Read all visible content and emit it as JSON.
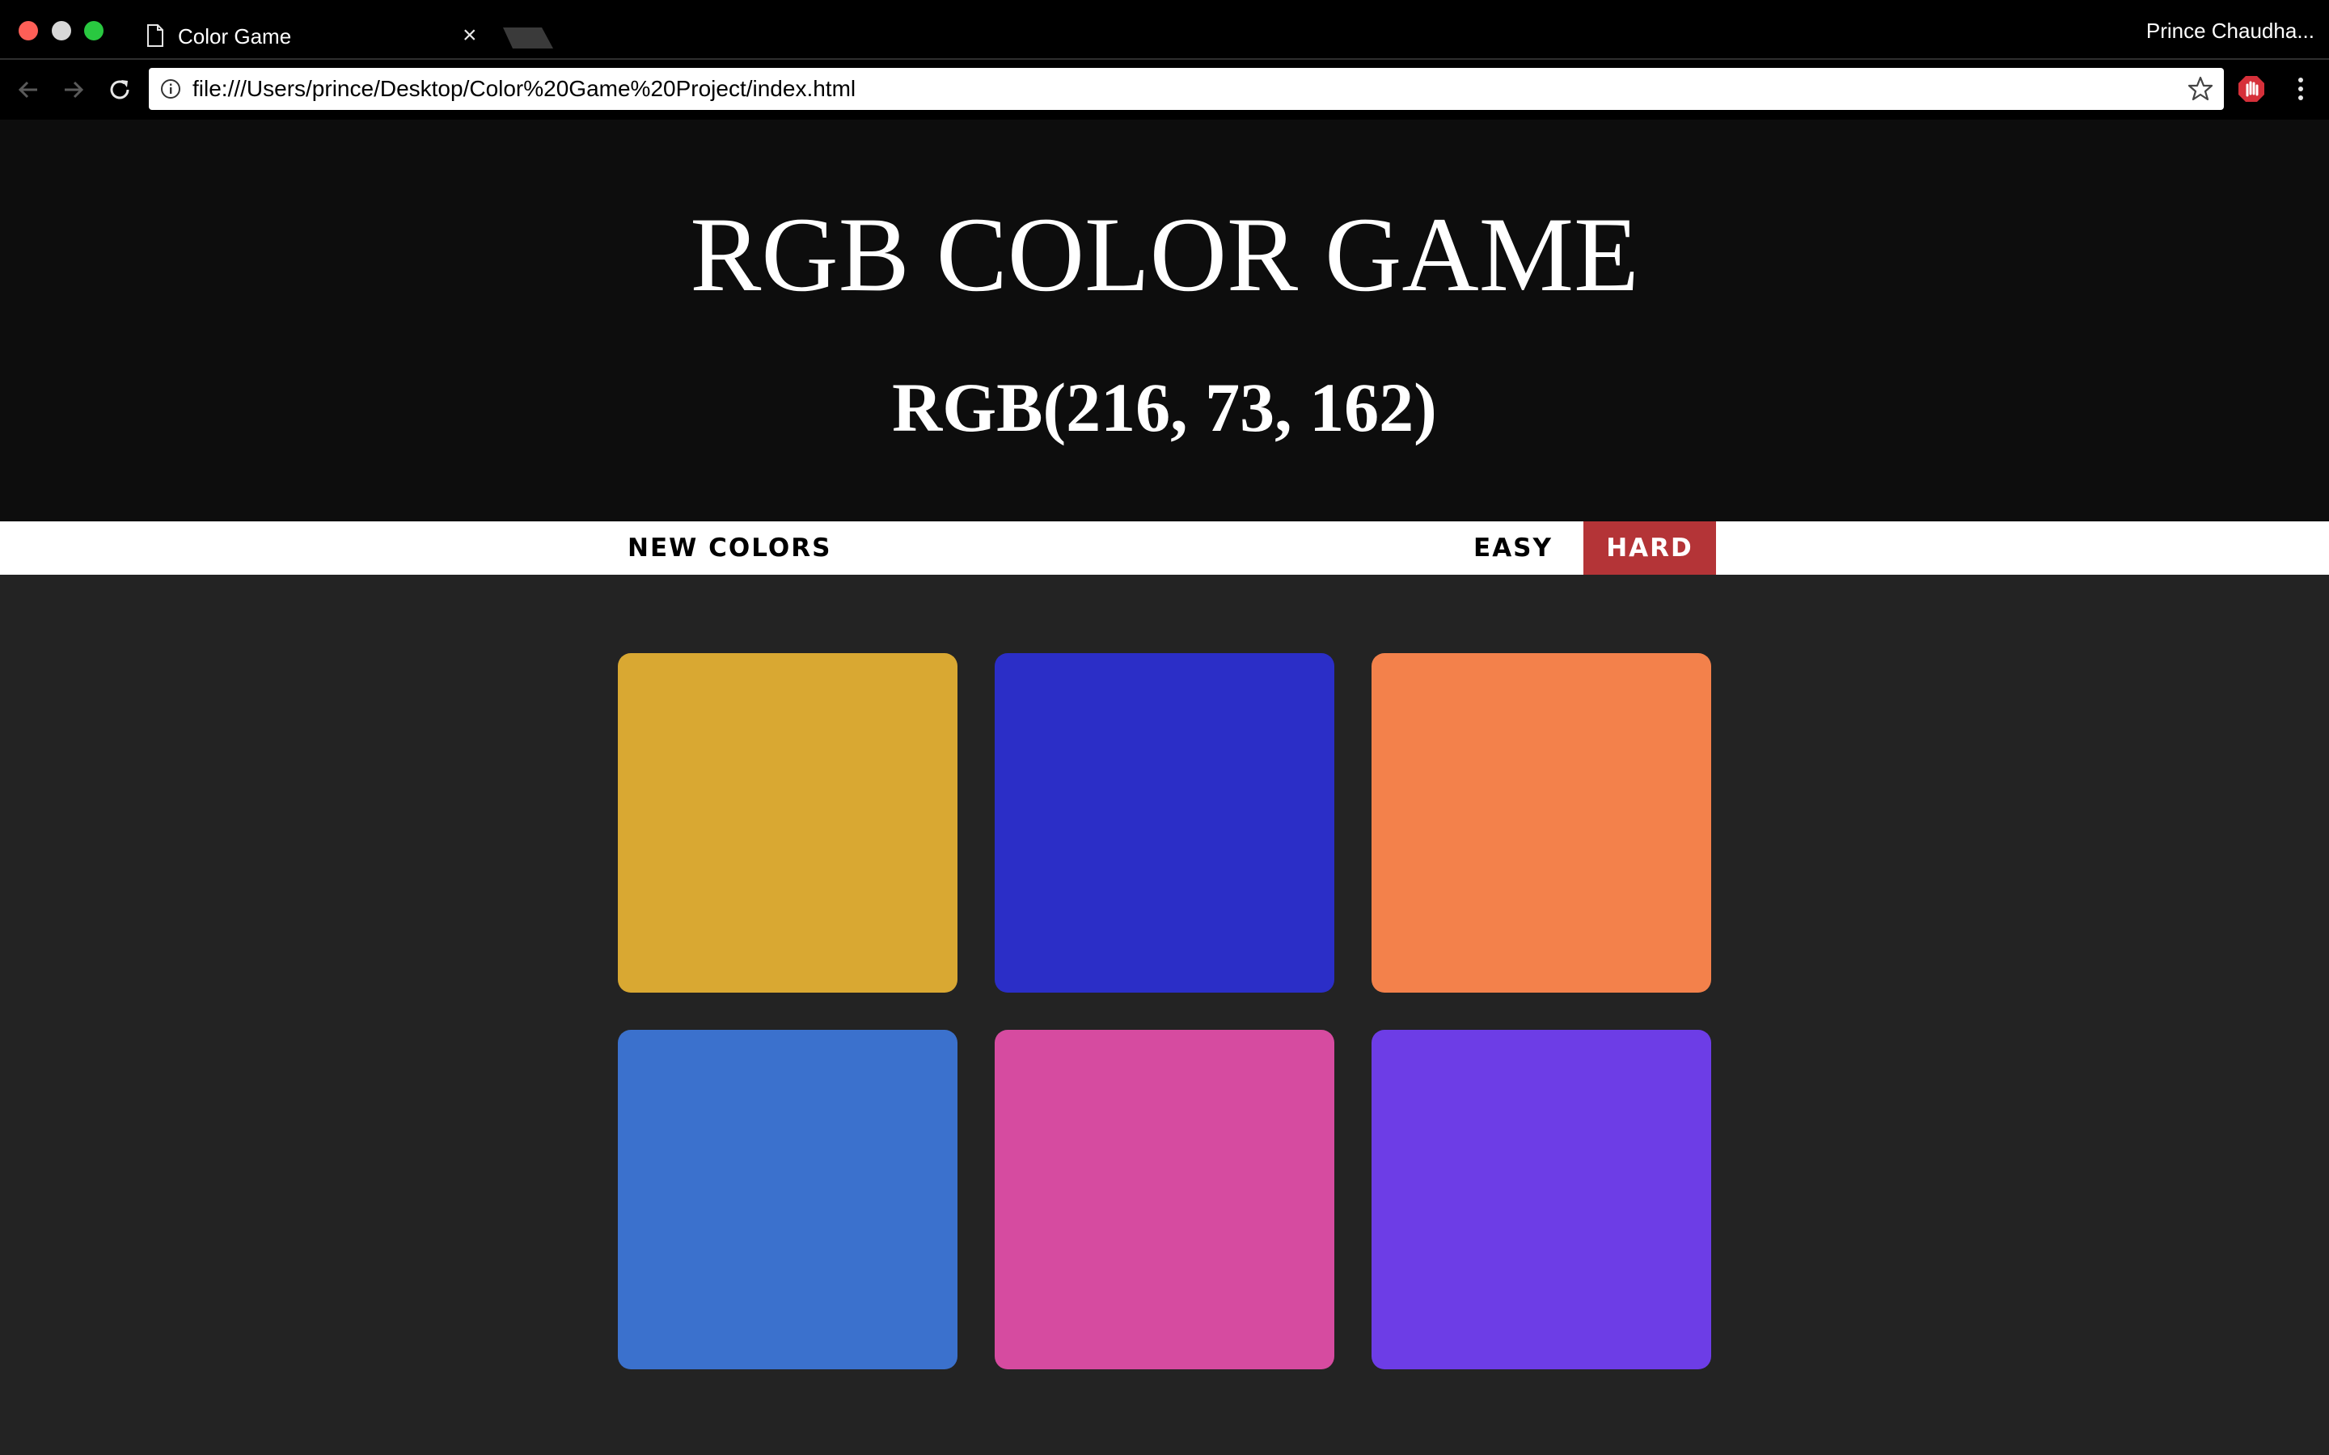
{
  "browser": {
    "tab_title": "Color Game",
    "tab_close": "×",
    "profile_name": "Prince Chaudha...",
    "url": "file:///Users/prince/Desktop/Color%20Game%20Project/index.html",
    "icons": [
      "document-icon",
      "back-icon",
      "forward-icon",
      "reload-icon",
      "info-icon",
      "star-icon",
      "extension-icon",
      "menu-icon"
    ]
  },
  "game": {
    "title": "RGB COLOR GAME",
    "target_color": "RGB(216, 73, 162)",
    "header_bg": "#0d0d0d",
    "hard_bg": "#b43437"
  },
  "controls": {
    "new_colors": "NEW COLORS",
    "easy": "EASY",
    "hard": "HARD",
    "selected_mode": "HARD"
  },
  "squares": [
    {
      "color": "#d9a832"
    },
    {
      "color": "#2b2ec7"
    },
    {
      "color": "#f3814b"
    },
    {
      "color": "#3b71cd"
    },
    {
      "color": "#d64ba0"
    },
    {
      "color": "#6d3de6"
    }
  ]
}
